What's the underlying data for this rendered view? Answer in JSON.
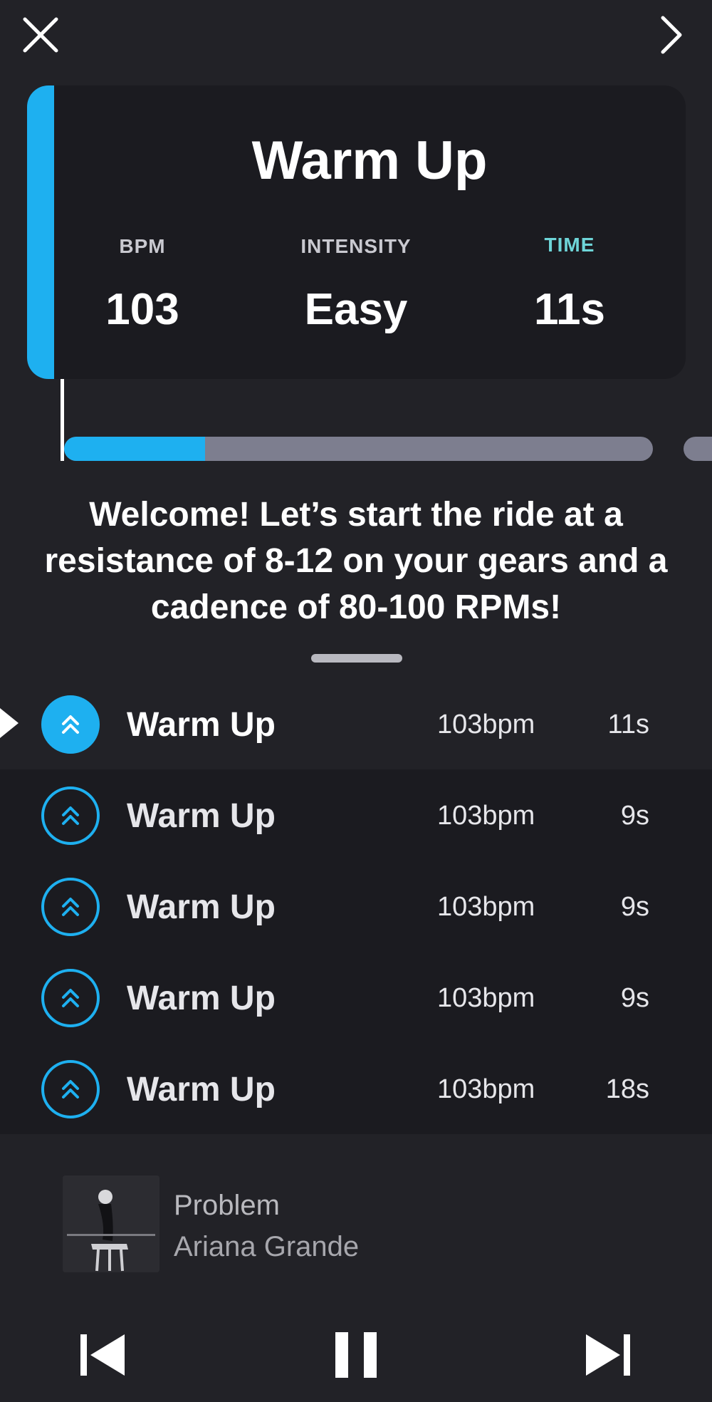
{
  "nav": {
    "close_icon": "close-icon",
    "next_icon": "chevron-right-icon"
  },
  "segment": {
    "title": "Warm Up",
    "stats": [
      {
        "label": "BPM",
        "value": "103"
      },
      {
        "label": "INTENSITY",
        "value": "Easy"
      },
      {
        "label": "TIME",
        "value": "11s"
      }
    ],
    "progress_fraction": 0.24,
    "accent_color": "#1eb0f0",
    "time_label_color": "#6ed5d8"
  },
  "message": "Welcome! Let’s start the ride at a resistance of 8-12 on your gears and a cadence of 80-100 RPMs!",
  "list": {
    "rows": [
      {
        "name": "Warm Up",
        "bpm": "103bpm",
        "time": "11s",
        "active": true
      },
      {
        "name": "Warm Up",
        "bpm": "103bpm",
        "time": "9s",
        "active": false
      },
      {
        "name": "Warm Up",
        "bpm": "103bpm",
        "time": "9s",
        "active": false
      },
      {
        "name": "Warm Up",
        "bpm": "103bpm",
        "time": "9s",
        "active": false
      },
      {
        "name": "Warm Up",
        "bpm": "103bpm",
        "time": "18s",
        "active": false
      }
    ]
  },
  "now_playing": {
    "title": "Problem",
    "artist": "Ariana Grande"
  },
  "controls": {
    "prev_icon": "skip-back-icon",
    "pause_icon": "pause-icon",
    "next_icon": "skip-forward-icon"
  }
}
